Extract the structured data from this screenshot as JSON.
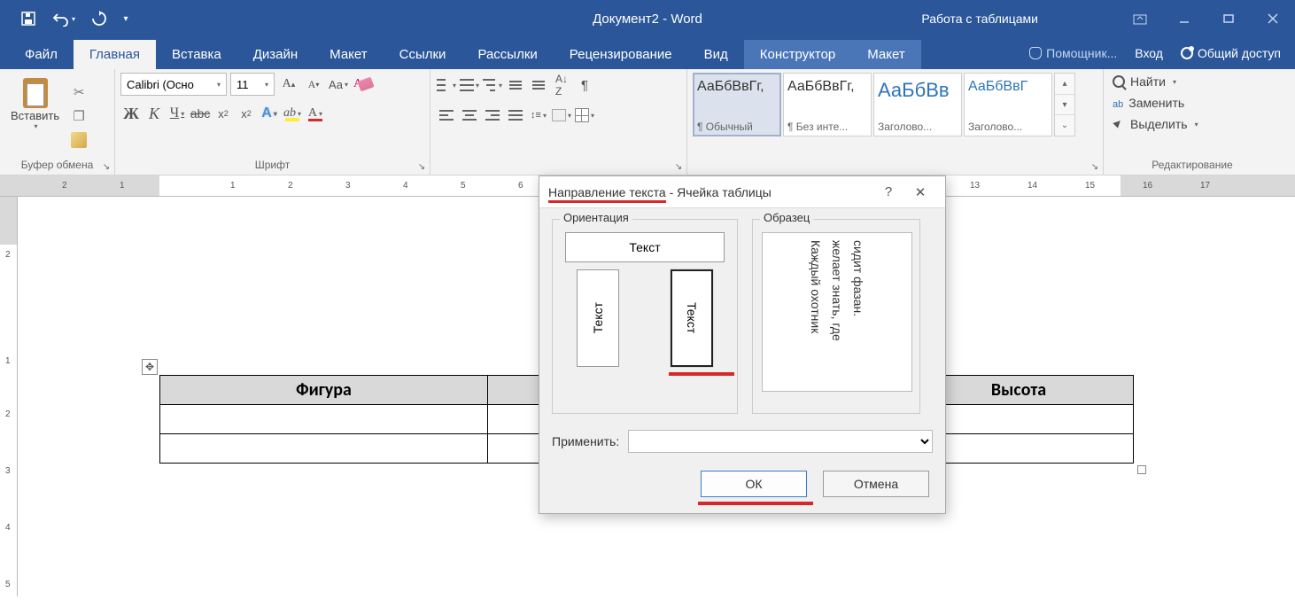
{
  "titlebar": {
    "doc_title": "Документ2 - Word",
    "table_tools_label": "Работа с таблицами"
  },
  "tabs": {
    "file": "Файл",
    "home": "Главная",
    "insert": "Вставка",
    "design": "Дизайн",
    "layout": "Макет",
    "references": "Ссылки",
    "mailings": "Рассылки",
    "review": "Рецензирование",
    "view": "Вид",
    "tbl_design": "Конструктор",
    "tbl_layout": "Макет",
    "tell_me": "Помощник...",
    "sign_in": "Вход",
    "share": "Общий доступ"
  },
  "ribbon": {
    "clipboard_label": "Буфер обмена",
    "paste": "Вставить",
    "font_label": "Шрифт",
    "font_name": "Calibri (Осно",
    "font_size": "11",
    "styles": {
      "s1_preview": "АаБбВвГг,",
      "s1_name": "¶ Обычный",
      "s2_preview": "АаБбВвГг,",
      "s2_name": "¶ Без инте...",
      "s3_preview": "АаБбВв",
      "s3_name": "Заголово...",
      "s4_preview": "АаБбВвГ",
      "s4_name": "Заголово..."
    },
    "editing_label": "Редактирование",
    "find": "Найти",
    "replace": "Заменить",
    "select": "Выделить"
  },
  "document": {
    "header1": "Фигура",
    "header2": "Высота"
  },
  "dialog": {
    "title_a": "Направление текста",
    "title_b": " - Ячейка таблицы",
    "orientation_label": "Ориентация",
    "sample_label": "Образец",
    "text_h": "Текст",
    "text_v1": "Текст",
    "text_v2": "Текст",
    "sample_l1": "Каждый охотник",
    "sample_l2": "желает знать, где",
    "sample_l3": "сидит фазан.",
    "apply_label": "Применить:",
    "ok": "ОК",
    "cancel": "Отмена"
  }
}
